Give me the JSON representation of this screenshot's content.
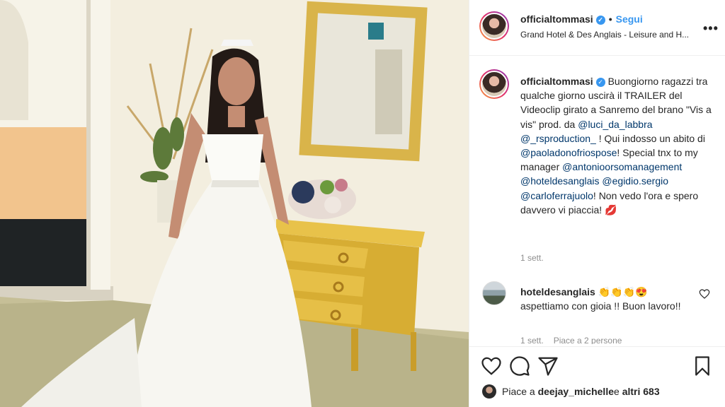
{
  "post": {
    "username": "officialtommasi",
    "verified_symbol": "✓",
    "dot": "•",
    "follow_label": "Segui",
    "location": "Grand Hotel & Des Anglais - Leisure and H...",
    "more_label": "•••"
  },
  "caption": {
    "username": "officialtommasi",
    "text_1": " Buongiorno ragazzi tra qualche giorno uscirà il TRAILER del Videoclip girato a Sanremo del brano \"Vis a vis\" prod. da ",
    "mention_1": "@luci_da_labbra",
    "mention_2": "@_rsproduction_",
    "text_2": " ! Qui indosso un abito di ",
    "mention_3": "@paoladonofriospose",
    "text_3": "! Special tnx to my manager ",
    "mention_4": "@antonioorsomanagement",
    "mention_5": "@hoteldesanglais",
    "mention_6": "@egidio.sergio",
    "mention_7": "@carloferrajuolo",
    "text_4": "! Non vedo l'ora e spero davvero vi piaccia! 💋",
    "time": "1 sett."
  },
  "comment": {
    "username": "hoteldesanglais",
    "text": " 👏👏👏😍 aspettiamo con gioia !! Buon lavoro!!",
    "time": "1 sett.",
    "likes": "Piace a 2 persone"
  },
  "likes": {
    "prefix": "Piace a ",
    "user": "deejay_michelle",
    "middle": " e ",
    "others": "altri 683"
  },
  "colors": {
    "accent": "#3897f0",
    "mention": "#00376b",
    "muted": "#8e8e8e"
  },
  "icons": [
    "heart-icon",
    "comment-icon",
    "share-icon",
    "bookmark-icon",
    "more-icon",
    "verified-icon"
  ]
}
